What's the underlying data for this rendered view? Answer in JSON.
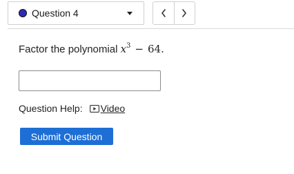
{
  "question_nav": {
    "selected_label": "Question 4",
    "status_color": "#2e2ab8",
    "prev_icon": "chevron-left-icon",
    "next_icon": "chevron-right-icon"
  },
  "question": {
    "prompt_text": "Factor the polynomial",
    "math": {
      "variable": "x",
      "exponent": "3",
      "operator": "−",
      "constant": "64."
    }
  },
  "answer": {
    "value": "",
    "placeholder": ""
  },
  "help": {
    "label": "Question Help:",
    "video_label": "Video",
    "video_icon": "video-icon"
  },
  "submit": {
    "label": "Submit Question",
    "color": "#1d6fd6"
  }
}
